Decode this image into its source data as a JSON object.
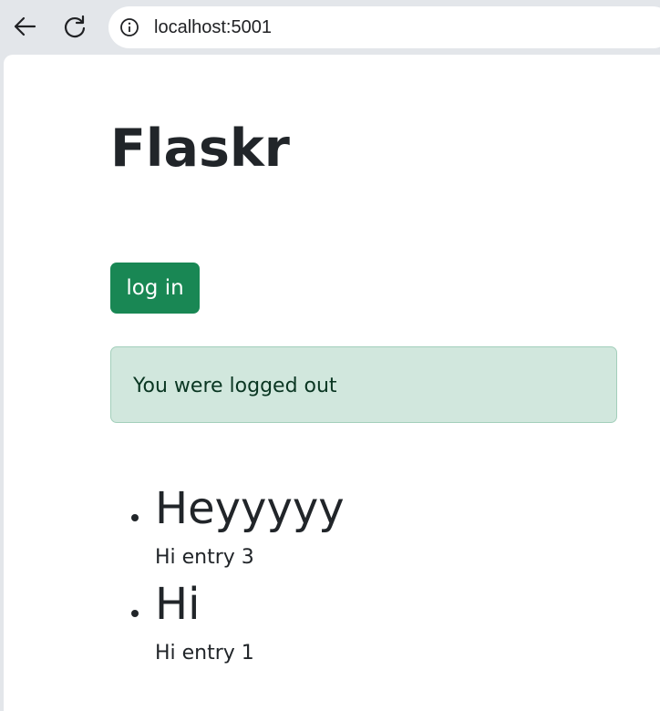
{
  "browser": {
    "url": "localhost:5001",
    "icons": {
      "back": "arrow-left-icon",
      "reload": "reload-icon",
      "info": "info-icon"
    }
  },
  "page": {
    "title": "Flaskr",
    "login_label": "log in",
    "flash_message": "You were logged out",
    "entries": [
      {
        "title": "Heyyyyy",
        "text": "Hi entry 3"
      },
      {
        "title": "Hi",
        "text": "Hi entry 1"
      }
    ]
  },
  "colors": {
    "login_button": "#198754",
    "flash_background": "#d1e7dd",
    "flash_text": "#0a3622",
    "text": "#212529"
  }
}
